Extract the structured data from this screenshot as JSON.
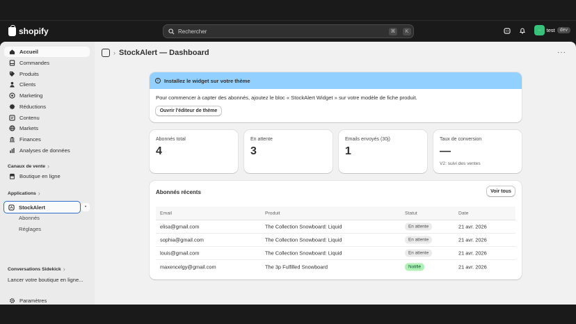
{
  "topbar": {
    "brand": "shopify",
    "search_placeholder": "Rechercher",
    "kbd1": "⌘",
    "kbd2": "K",
    "user_initials": "·∙",
    "user_name": "test",
    "env_badge": "dev"
  },
  "sidebar": {
    "items": [
      {
        "label": "Accueil",
        "icon": "home-icon"
      },
      {
        "label": "Commandes",
        "icon": "orders-icon"
      },
      {
        "label": "Produits",
        "icon": "tag-icon"
      },
      {
        "label": "Clients",
        "icon": "person-icon"
      },
      {
        "label": "Marketing",
        "icon": "target-icon"
      },
      {
        "label": "Réductions",
        "icon": "discount-icon"
      },
      {
        "label": "Contenu",
        "icon": "content-icon"
      },
      {
        "label": "Markets",
        "icon": "globe-icon"
      },
      {
        "label": "Finances",
        "icon": "bank-icon"
      },
      {
        "label": "Analyses de données",
        "icon": "chart-icon"
      }
    ],
    "sales_channels_label": "Canaux de vente",
    "online_store": "Boutique en ligne",
    "apps_label": "Applications",
    "app_name": "StockAlert",
    "app_sub1": "Abonnés",
    "app_sub2": "Réglages",
    "sidekick_label": "Conversations Sidekick",
    "sidekick_item": "Lancer votre boutique en ligne...",
    "settings": "Paramètres"
  },
  "page": {
    "title": "StockAlert — Dashboard",
    "banner_title": "Installez le widget sur votre thème",
    "banner_text": "Pour commencer à capter des abonnés, ajoutez le bloc « StockAlert Widget » sur votre modèle de fiche produit.",
    "banner_button": "Ouvrir l'éditeur de thème",
    "stats": [
      {
        "label": "Abonnés total",
        "value": "4",
        "sub": ""
      },
      {
        "label": "En attente",
        "value": "3",
        "sub": ""
      },
      {
        "label": "Emails envoyés (30j)",
        "value": "1",
        "sub": ""
      },
      {
        "label": "Taux de conversion",
        "value": "—",
        "sub": "V2: suivi des ventes"
      }
    ],
    "recent_title": "Abonnés récents",
    "view_all": "Voir tous",
    "columns": [
      "Email",
      "Produit",
      "Statut",
      "Date"
    ],
    "rows": [
      {
        "email": "elisa@gmail.com",
        "product": "The Collection Snowboard: Liquid",
        "status": "En attente",
        "date": "21 avr. 2026"
      },
      {
        "email": "sophia@gmail.com",
        "product": "The Collection Snowboard: Liquid",
        "status": "En attente",
        "date": "21 avr. 2026"
      },
      {
        "email": "louis@gmail.com",
        "product": "The Collection Snowboard: Liquid",
        "status": "En attente",
        "date": "21 avr. 2026"
      },
      {
        "email": "maxencelgy@gmail.com",
        "product": "The 3p Fulfilled Snowboard",
        "status": "Notifié",
        "date": "21 avr. 2026"
      }
    ]
  },
  "colors": {
    "banner": "#91d0ff",
    "success_badge": "#aff0b5",
    "focus": "#2c6ecb"
  }
}
